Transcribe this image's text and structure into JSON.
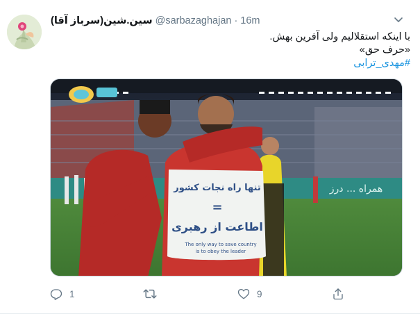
{
  "tweet": {
    "display_name": "سین.شین(سرباز آقا)",
    "handle": "@sarbazaghajan",
    "separator": "·",
    "time": "16m",
    "text_line1": "با اینکه استقلالیم ولی آفرین بهش.",
    "text_line2": "«حرف حق»",
    "hashtag": "#مهدی_ترابی"
  },
  "media": {
    "shirt_line1": "تنها راه نجات کشور",
    "shirt_line2": "=",
    "shirt_line3": "اطاعت از رهبری",
    "shirt_english1": "The only way to save country",
    "shirt_english2": "is to obey the leader",
    "banner_text": "همراه ... درز"
  },
  "actions": {
    "reply_count": "1",
    "retweet_count": "",
    "like_count": "9"
  },
  "icons": {
    "reply": "reply-icon",
    "retweet": "retweet-icon",
    "like": "heart-icon",
    "share": "share-icon",
    "caret": "chevron-down-icon"
  },
  "colors": {
    "link": "#1b95e0",
    "secondary_text": "#657786",
    "primary_text": "#14171a"
  }
}
